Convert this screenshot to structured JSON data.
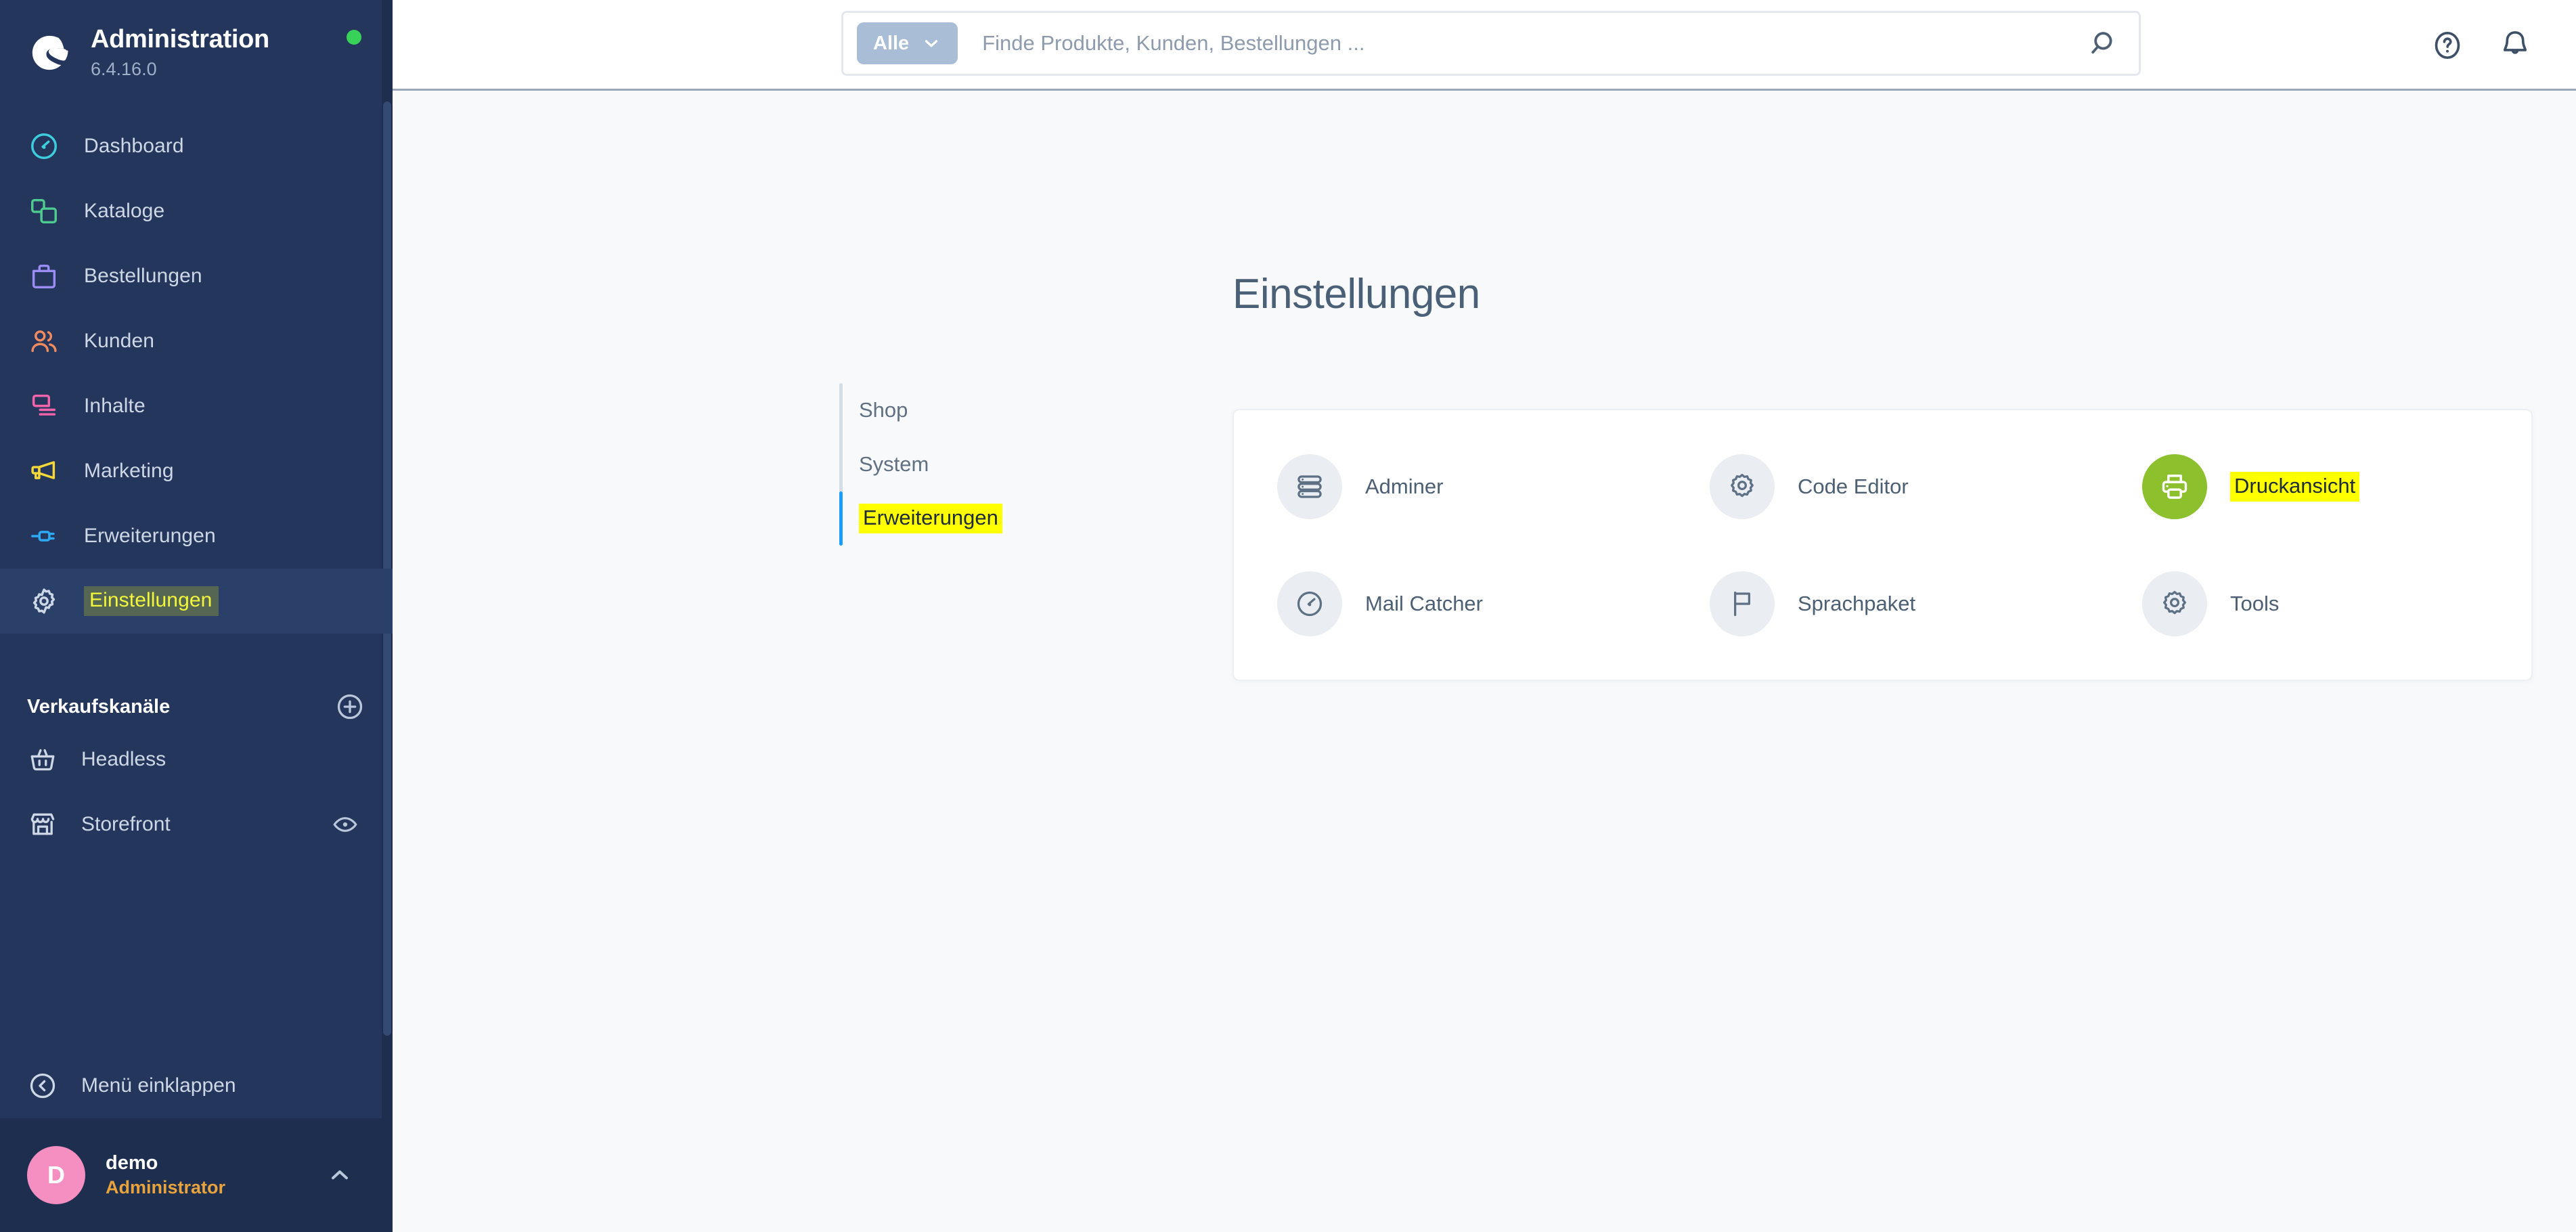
{
  "sidebar": {
    "brand": {
      "title": "Administration",
      "version": "6.4.16.0",
      "logo_icon": "shopware-logo-icon",
      "status_icon": "status-dot-online"
    },
    "nav": [
      {
        "label": "Dashboard",
        "icon": "dashboard-speedometer-icon",
        "color": "#3ecfdf",
        "active": false,
        "highlighted": false
      },
      {
        "label": "Kataloge",
        "icon": "catalogs-layers-icon",
        "color": "#4ecb8e",
        "active": false,
        "highlighted": false
      },
      {
        "label": "Bestellungen",
        "icon": "orders-bag-icon",
        "color": "#9c8cf5",
        "active": false,
        "highlighted": false
      },
      {
        "label": "Kunden",
        "icon": "customers-people-icon",
        "color": "#f08a5f",
        "active": false,
        "highlighted": false
      },
      {
        "label": "Inhalte",
        "icon": "content-document-icon",
        "color": "#f364ab",
        "active": false,
        "highlighted": false
      },
      {
        "label": "Marketing",
        "icon": "marketing-megaphone-icon",
        "color": "#f4d738",
        "active": false,
        "highlighted": false
      },
      {
        "label": "Erweiterungen",
        "icon": "extensions-plug-icon",
        "color": "#2eaaf5",
        "active": false,
        "highlighted": false
      },
      {
        "label": "Einstellungen",
        "icon": "settings-gear-icon",
        "color": "#cdd7e5",
        "active": true,
        "highlighted": true
      }
    ],
    "sales_channels": {
      "title": "Verkaufskanäle",
      "add_icon": "plus-circle-icon",
      "items": [
        {
          "label": "Headless",
          "icon": "headless-basket-icon",
          "has_preview": false
        },
        {
          "label": "Storefront",
          "icon": "storefront-shop-icon",
          "has_preview": true,
          "preview_icon": "eye-icon"
        }
      ]
    },
    "collapse": {
      "label": "Menü einklappen",
      "icon": "collapse-left-circle-icon"
    },
    "user": {
      "avatar_initial": "D",
      "avatar_color": "#f58ec1",
      "name": "demo",
      "role": "Administrator",
      "caret_icon": "chevron-up-icon"
    }
  },
  "topbar": {
    "search": {
      "scope_label": "Alle",
      "scope_caret_icon": "chevron-down-icon",
      "value": "",
      "placeholder": "Finde Produkte, Kunden, Bestellungen ...",
      "submit_icon": "search-icon"
    },
    "actions": [
      {
        "name": "help",
        "icon": "question-circle-icon"
      },
      {
        "name": "notifications",
        "icon": "bell-icon"
      }
    ]
  },
  "page": {
    "title": "Einstellungen",
    "tabs": [
      {
        "label": "Shop",
        "active": false,
        "highlighted": false
      },
      {
        "label": "System",
        "active": false,
        "highlighted": false
      },
      {
        "label": "Erweiterungen",
        "active": true,
        "highlighted": true
      }
    ],
    "cards": [
      {
        "label": "Adminer",
        "icon": "database-server-icon",
        "accent": false,
        "highlighted": false
      },
      {
        "label": "Code Editor",
        "icon": "gear-icon",
        "accent": false,
        "highlighted": false
      },
      {
        "label": "Druckansicht",
        "icon": "printer-icon",
        "accent": true,
        "highlighted": true
      },
      {
        "label": "Mail Catcher",
        "icon": "speedometer-icon",
        "accent": false,
        "highlighted": false
      },
      {
        "label": "Sprachpaket",
        "icon": "flag-icon",
        "accent": false,
        "highlighted": false
      },
      {
        "label": "Tools",
        "icon": "gear-icon",
        "accent": false,
        "highlighted": false
      }
    ]
  },
  "colors": {
    "sidebar_bg": "#24365c",
    "sidebar_active": "#2b4068",
    "sidebar_user_bg": "#1d2e4f",
    "content_bg": "#f8f9fb",
    "accent_green": "#8cc02c",
    "accent_blue": "#189eff",
    "highlight_yellow": "#ffff00",
    "title_color": "#4a6076"
  }
}
